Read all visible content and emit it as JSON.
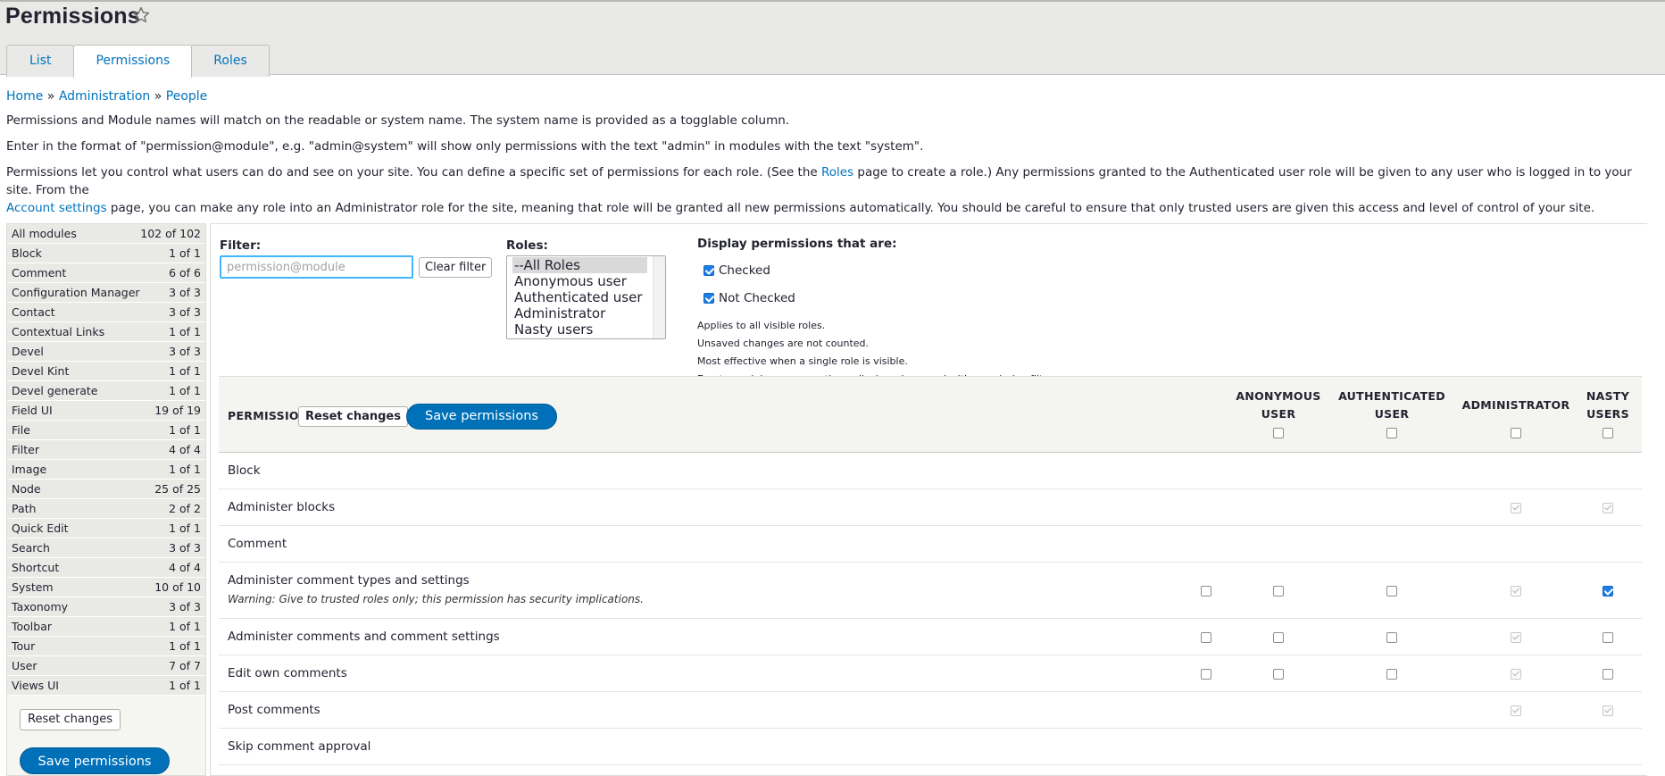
{
  "page": {
    "title": "Permissions"
  },
  "tabs": [
    {
      "label": "List"
    },
    {
      "label": "Permissions"
    },
    {
      "label": "Roles"
    }
  ],
  "breadcrumb": {
    "home": "Home",
    "sep1": "»",
    "admin": "Administration",
    "sep2": "»",
    "people": "People"
  },
  "help": {
    "line1": "Permissions and Module names will match on the readable or system name. The system name is provided as a togglable column.",
    "line2": "Enter in the format of \"permission@module\", e.g. \"admin@system\" will show only permissions with the text \"admin\" in modules with the text \"system\".",
    "line3_a": "Permissions let you control what users can do and see on your site. You can define a specific set of permissions for each role. (See the ",
    "line3_roles_link": "Roles",
    "line3_b": " page to create a role.) Any permissions granted to the Authenticated user role will be given to any user who is logged in to your site. From the",
    "line3_account_link": "Account settings",
    "line3_c": " page, you can make any role into an Administrator role for the site, meaning that role will be granted all new permissions automatically. You should be careful to ensure that only trusted users are given this access and level of control of your site."
  },
  "sidebar": {
    "modules": [
      {
        "name": "All modules",
        "count": "102 of 102"
      },
      {
        "name": "Block",
        "count": "1 of 1"
      },
      {
        "name": "Comment",
        "count": "6 of 6"
      },
      {
        "name": "Configuration Manager",
        "count": "3 of 3"
      },
      {
        "name": "Contact",
        "count": "3 of 3"
      },
      {
        "name": "Contextual Links",
        "count": "1 of 1"
      },
      {
        "name": "Devel",
        "count": "3 of 3"
      },
      {
        "name": "Devel Kint",
        "count": "1 of 1"
      },
      {
        "name": "Devel generate",
        "count": "1 of 1"
      },
      {
        "name": "Field UI",
        "count": "19 of 19"
      },
      {
        "name": "File",
        "count": "1 of 1"
      },
      {
        "name": "Filter",
        "count": "4 of 4"
      },
      {
        "name": "Image",
        "count": "1 of 1"
      },
      {
        "name": "Node",
        "count": "25 of 25"
      },
      {
        "name": "Path",
        "count": "2 of 2"
      },
      {
        "name": "Quick Edit",
        "count": "1 of 1"
      },
      {
        "name": "Search",
        "count": "3 of 3"
      },
      {
        "name": "Shortcut",
        "count": "4 of 4"
      },
      {
        "name": "System",
        "count": "10 of 10"
      },
      {
        "name": "Taxonomy",
        "count": "3 of 3"
      },
      {
        "name": "Toolbar",
        "count": "1 of 1"
      },
      {
        "name": "Tour",
        "count": "1 of 1"
      },
      {
        "name": "User",
        "count": "7 of 7"
      },
      {
        "name": "Views UI",
        "count": "1 of 1"
      }
    ],
    "reset_label": "Reset changes",
    "save_label": "Save permissions"
  },
  "filter": {
    "label": "Filter:",
    "placeholder": "permission@module",
    "clear_label": "Clear filter"
  },
  "roles_select": {
    "label": "Roles:",
    "options": [
      "--All Roles",
      "Anonymous user",
      "Authenticated user",
      "Administrator",
      "Nasty users"
    ],
    "selected": "--All Roles"
  },
  "display": {
    "label": "Display permissions that are:",
    "checked_label": "Checked",
    "not_checked_label": "Not Checked",
    "checked": true,
    "not_checked": true,
    "notes": [
      "Applies to all visible roles.",
      "Unsaved changes are not counted.",
      "Most effective when a single role is visible.",
      "Empty module rows sometimes display when used with permission filter."
    ]
  },
  "table": {
    "permission_header": "PERMISSION",
    "reset_label": "Reset changes",
    "save_label": "Save permissions",
    "roles": [
      {
        "line1": "ANONYMOUS",
        "line2": "USER"
      },
      {
        "line1": "AUTHENTICATED",
        "line2": "USER"
      },
      {
        "line1": "ADMINISTRATOR",
        "line2": ""
      },
      {
        "line1": "NASTY",
        "line2": "USERS"
      }
    ],
    "rows": [
      {
        "type": "module",
        "label": "Block"
      },
      {
        "type": "perm",
        "label": "Administer blocks",
        "admin": "dim",
        "nasty": "dim"
      },
      {
        "type": "module",
        "label": "Comment"
      },
      {
        "type": "perm",
        "label": "Administer comment types and settings",
        "warning": "Warning: Give to trusted roles only; this permission has security implications.",
        "admin": "dim",
        "nasty": "checked"
      },
      {
        "type": "perm",
        "label": "Administer comments and comment settings",
        "admin": "dim",
        "nasty": "empty"
      },
      {
        "type": "perm",
        "label": "Edit own comments",
        "admin": "dim",
        "nasty": "empty"
      },
      {
        "type": "perm",
        "label": "Post comments",
        "admin": "dim",
        "nasty": "dim"
      },
      {
        "type": "perm",
        "label": "Skip comment approval"
      }
    ]
  },
  "icons": {
    "star": "star-outline-icon"
  },
  "colors": {
    "link": "#0074bd",
    "primary_button": "#0071b8",
    "checkbox_checked": "#1d7fe6"
  }
}
